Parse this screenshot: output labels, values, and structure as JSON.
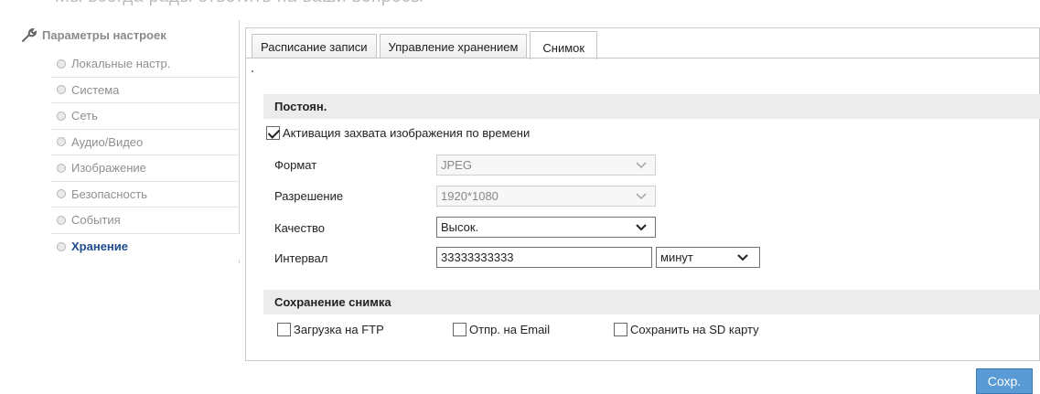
{
  "header_cut_text": "Мы всегда рады ответить на ваши вопросы",
  "sidebar": {
    "title": "Параметры настроек",
    "items": [
      {
        "label": "Локальные настр."
      },
      {
        "label": "Система"
      },
      {
        "label": "Сеть"
      },
      {
        "label": "Аудио/Видео"
      },
      {
        "label": "Изображение"
      },
      {
        "label": "Безопасность"
      },
      {
        "label": "События"
      },
      {
        "label": "Хранение",
        "active": true
      }
    ]
  },
  "tabs": [
    {
      "label": "Расписание записи"
    },
    {
      "label": "Управление хранением"
    },
    {
      "label": "Снимок",
      "active": true
    }
  ],
  "timing_section": {
    "title": "Постоян.",
    "enable_label": "Активация захвата изображения по времени",
    "enable_checked": true,
    "format": {
      "label": "Формат",
      "value": "JPEG",
      "disabled": true
    },
    "resolution": {
      "label": "Разрешение",
      "value": "1920*1080",
      "disabled": true
    },
    "quality": {
      "label": "Качество",
      "value": "Высок."
    },
    "interval": {
      "label": "Интервал",
      "value": "33333333333",
      "unit": "минут"
    }
  },
  "save_section": {
    "title": "Сохранение снимка",
    "options": [
      {
        "label": "Загрузка на FTP",
        "checked": false
      },
      {
        "label": "Отпр. на Email",
        "checked": false
      },
      {
        "label": "Сохранить на SD карту",
        "checked": false
      }
    ]
  },
  "save_button": "Сохр."
}
